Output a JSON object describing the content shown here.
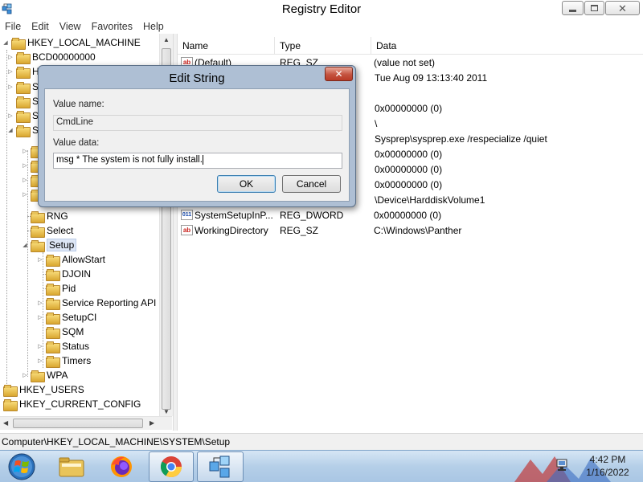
{
  "window": {
    "title": "Registry Editor",
    "minimize_icon": "minimize-icon",
    "maximize_icon": "restore-icon",
    "close_icon": "close-icon"
  },
  "menu": [
    "File",
    "Edit",
    "View",
    "Favorites",
    "Help"
  ],
  "tree": {
    "root": "HKEY_LOCAL_MACHINE",
    "items": {
      "bcd": "BCD00000000",
      "hw_partial": "H",
      "sam_partial": "S",
      "sec_partial": "S",
      "soft_partial": "S",
      "sys_partial": "S",
      "rng": "RNG",
      "select": "Select",
      "setup": "Setup",
      "allowstart": "AllowStart",
      "djoin": "DJOIN",
      "pid": "Pid",
      "service_reporting": "Service Reporting API",
      "setupci": "SetupCI",
      "sqm": "SQM",
      "status": "Status",
      "timers": "Timers",
      "wpa": "WPA",
      "hku": "HKEY_USERS",
      "hkcc": "HKEY_CURRENT_CONFIG"
    }
  },
  "list": {
    "headers": {
      "name": "Name",
      "type": "Type",
      "data": "Data"
    },
    "rows": [
      {
        "name": "(Default)",
        "type": "REG_SZ",
        "data": "(value not set)",
        "kind": "string"
      },
      {
        "name": "",
        "type": "",
        "data": "Tue Aug 09 13:13:40 2011",
        "kind": "hidden"
      },
      {
        "name": "",
        "type": "",
        "data": "",
        "kind": "hidden"
      },
      {
        "name": "",
        "type": "",
        "data": "0x00000000 (0)",
        "kind": "hidden"
      },
      {
        "name": "",
        "type": "",
        "data": "\\",
        "kind": "hidden"
      },
      {
        "name": "",
        "type": "",
        "data": "Sysprep\\sysprep.exe /respecialize /quiet",
        "kind": "hidden"
      },
      {
        "name": "",
        "type": "",
        "data": "0x00000000 (0)",
        "kind": "hidden"
      },
      {
        "name": "",
        "type": "",
        "data": "0x00000000 (0)",
        "kind": "hidden"
      },
      {
        "name": "",
        "type": "",
        "data": "0x00000000 (0)",
        "kind": "hidden"
      },
      {
        "name": "",
        "type": "",
        "data": "\\Device\\HarddiskVolume1",
        "kind": "hidden"
      },
      {
        "name": "SystemSetupInP...",
        "type": "REG_DWORD",
        "data": "0x00000000 (0)",
        "kind": "binary"
      },
      {
        "name": "WorkingDirectory",
        "type": "REG_SZ",
        "data": "C:\\Windows\\Panther",
        "kind": "string"
      }
    ]
  },
  "status_bar": "Computer\\HKEY_LOCAL_MACHINE\\SYSTEM\\Setup",
  "dialog": {
    "title": "Edit String",
    "value_name_label": "Value name:",
    "value_name": "CmdLine",
    "value_data_label": "Value data:",
    "value_data": "msg * The system is not fully install.",
    "ok": "OK",
    "cancel": "Cancel",
    "close_icon": "close-icon"
  },
  "taskbar": {
    "start_icon": "windows-start-icon",
    "apps": [
      "explorer-icon",
      "firefox-icon",
      "chrome-icon",
      "regedit-icon"
    ],
    "time": "4:42 PM",
    "date": "1/16/2022",
    "network_icon": "network-icon"
  },
  "colors": {
    "selection": "#dde6f5",
    "dialog_frame": "#aebfd4",
    "taskbar": "#b5cfe8",
    "close_red": "#c4533f"
  }
}
